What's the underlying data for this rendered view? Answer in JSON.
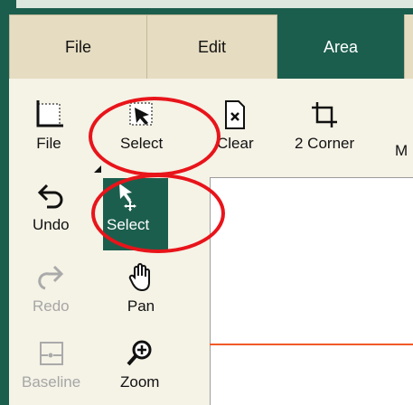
{
  "tabs": {
    "file": "File",
    "edit": "Edit",
    "area": "Area",
    "active": "Area"
  },
  "toolbar_row1": {
    "file": "File",
    "select": "Select",
    "clear": "Clear",
    "two_corner": "2 Corner",
    "cutoff": "M"
  },
  "toolbar_col": {
    "undo": "Undo",
    "select_active": "Select",
    "redo": "Redo",
    "pan": "Pan",
    "baseline": "Baseline",
    "zoom": "Zoom"
  },
  "icons": {
    "file": "area-file-icon",
    "select": "select-area-icon",
    "clear": "clear-area-icon",
    "two_corner": "crop-icon",
    "undo": "undo-icon",
    "select_active": "select-move-icon",
    "redo": "redo-icon",
    "pan": "hand-pan-icon",
    "baseline": "baseline-icon",
    "zoom": "zoom-in-icon"
  },
  "colors": {
    "accent": "#1c5e4d",
    "tab_bg": "#e6dcc1",
    "ribbon_bg": "#f5f2e6",
    "annotation_red": "#e8141a",
    "canvas_line": "#f05a28"
  }
}
